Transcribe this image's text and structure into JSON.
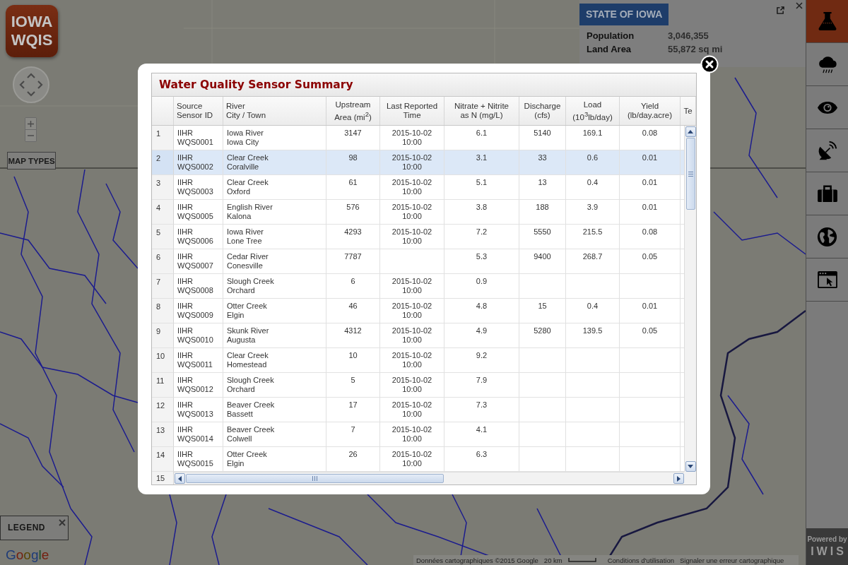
{
  "logo": {
    "text": "IOWA\nWQIS"
  },
  "map": {
    "map_types": "MAP TYPES",
    "legend": {
      "label": "LEGEND"
    },
    "attribution": {
      "logo": "Google",
      "data": "Données cartographiques ©2015 Google",
      "scale": "20 km",
      "terms": "Conditions d'utilisation",
      "report": "Signaler une erreur cartographique"
    }
  },
  "info_panel": {
    "title": "STATE OF IOWA",
    "rows": [
      {
        "label": "Population",
        "value": "3,046,355"
      },
      {
        "label": "Land Area",
        "value": "55,872 sq mi"
      }
    ]
  },
  "sidebar": {
    "items": [
      {
        "selected": true
      },
      {
        "selected": false
      },
      {
        "selected": false
      },
      {
        "selected": false
      },
      {
        "selected": false
      },
      {
        "selected": false
      },
      {
        "selected": false
      }
    ],
    "footer": {
      "line_1": "Powered by",
      "line_2": "IWIS"
    }
  },
  "dialog": {
    "title": "Water Quality Sensor Summary",
    "table": {
      "columns": [
        "Source\nSensor ID",
        "River\nCity / Town",
        "Upstream\nArea (mi$^{2}$)",
        "Last Reported\nTime",
        "Nitrate + Nitrite\nas N (mg/L)",
        "Discharge\n(cfs)",
        "Load\n(10$^{3}$lb/day)",
        "Yield\n(lb/day.acre)",
        "Te"
      ],
      "rows": [
        {
          "number": "1",
          "sensor": "IIHR\nWQS0001",
          "river": "Iowa River\nIowa City",
          "area": "3147",
          "time": "2015-10-02\n10:00",
          "nitrate": "6.1",
          "discharge": "5140",
          "load": "169.1",
          "yield": "0.08",
          "selected": false
        },
        {
          "number": "2",
          "sensor": "IIHR\nWQS0002",
          "river": "Clear Creek\nCoralville",
          "area": "98",
          "time": "2015-10-02\n10:00",
          "nitrate": "3.1",
          "discharge": "33",
          "load": "0.6",
          "yield": "0.01",
          "selected": true
        },
        {
          "number": "3",
          "sensor": "IIHR\nWQS0003",
          "river": "Clear Creek\nOxford",
          "area": "61",
          "time": "2015-10-02\n10:00",
          "nitrate": "5.1",
          "discharge": "13",
          "load": "0.4",
          "yield": "0.01",
          "selected": false
        },
        {
          "number": "4",
          "sensor": "IIHR\nWQS0005",
          "river": "English River\nKalona",
          "area": "576",
          "time": "2015-10-02\n10:00",
          "nitrate": "3.8",
          "discharge": "188",
          "load": "3.9",
          "yield": "0.01",
          "selected": false
        },
        {
          "number": "5",
          "sensor": "IIHR\nWQS0006",
          "river": "Iowa River\nLone Tree",
          "area": "4293",
          "time": "2015-10-02\n10:00",
          "nitrate": "7.2",
          "discharge": "5550",
          "load": "215.5",
          "yield": "0.08",
          "selected": false
        },
        {
          "number": "6",
          "sensor": "IIHR\nWQS0007",
          "river": "Cedar River\nConesville",
          "area": "7787",
          "nitrate": "5.3",
          "discharge": "9400",
          "load": "268.7",
          "yield": "0.05",
          "selected": false
        },
        {
          "number": "7",
          "sensor": "IIHR\nWQS0008",
          "river": "Slough Creek\nOrchard",
          "area": "6",
          "time": "2015-10-02\n10:00",
          "nitrate": "0.9",
          "selected": false
        },
        {
          "number": "8",
          "sensor": "IIHR\nWQS0009",
          "river": "Otter Creek\nElgin",
          "area": "46",
          "time": "2015-10-02\n10:00",
          "nitrate": "4.8",
          "discharge": "15",
          "load": "0.4",
          "yield": "0.01",
          "selected": false
        },
        {
          "number": "9",
          "sensor": "IIHR\nWQS0010",
          "river": "Skunk River\nAugusta",
          "area": "4312",
          "time": "2015-10-02\n10:00",
          "nitrate": "4.9",
          "discharge": "5280",
          "load": "139.5",
          "yield": "0.05",
          "selected": false
        },
        {
          "number": "10",
          "sensor": "IIHR\nWQS0011",
          "river": "Clear Creek\nHomestead",
          "area": "10",
          "time": "2015-10-02\n10:00",
          "nitrate": "9.2",
          "selected": false
        },
        {
          "number": "11",
          "sensor": "IIHR\nWQS0012",
          "river": "Slough Creek\nOrchard",
          "area": "5",
          "time": "2015-10-02\n10:00",
          "nitrate": "7.9",
          "selected": false
        },
        {
          "number": "12",
          "sensor": "IIHR\nWQS0013",
          "river": "Beaver Creek\nBassett",
          "area": "17",
          "time": "2015-10-02\n10:00",
          "nitrate": "7.3",
          "selected": false
        },
        {
          "number": "13",
          "sensor": "IIHR\nWQS0014",
          "river": "Beaver Creek\nColwell",
          "area": "7",
          "time": "2015-10-02\n10:00",
          "nitrate": "4.1",
          "selected": false
        },
        {
          "number": "14",
          "sensor": "IIHR\nWQS0015",
          "river": "Otter Creek\nElgin",
          "area": "26",
          "time": "2015-10-02\n10:00",
          "nitrate": "6.3",
          "selected": false
        }
      ],
      "partial_row_number": "15"
    }
  }
}
